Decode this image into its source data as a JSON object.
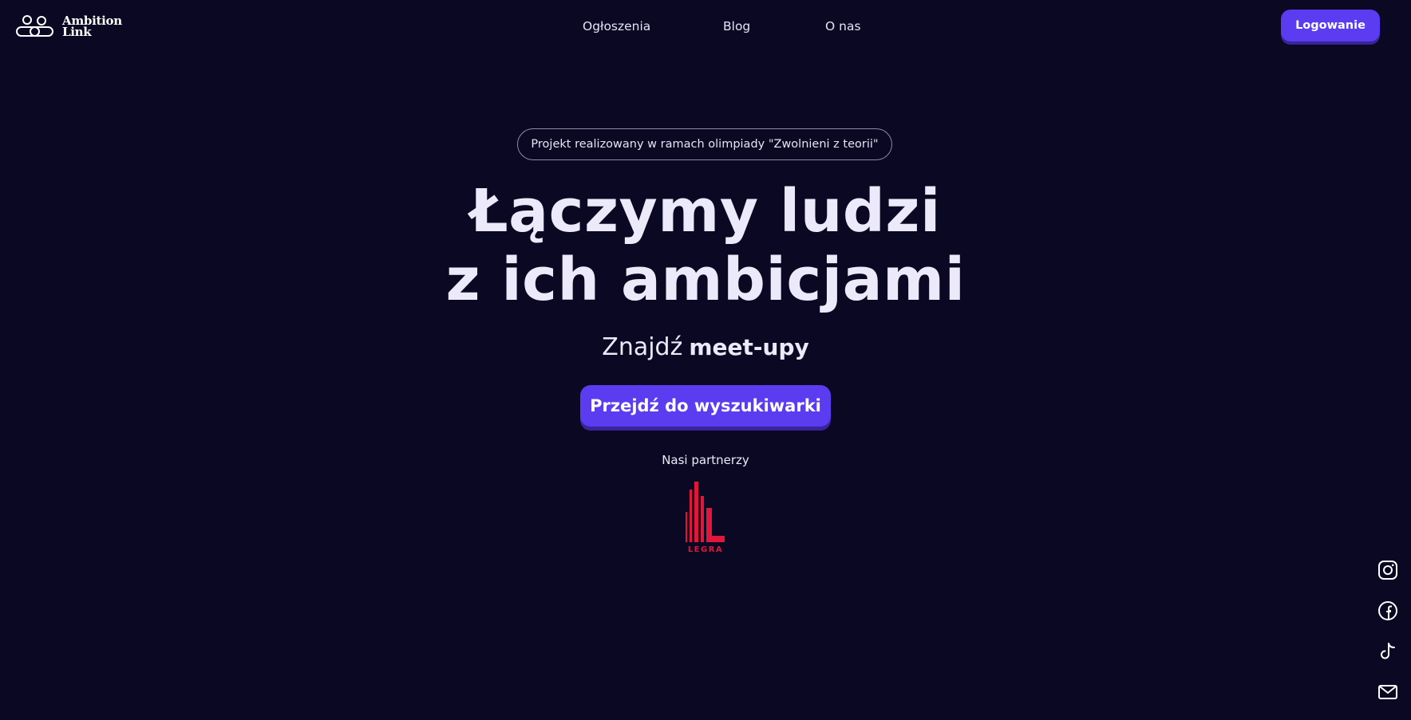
{
  "header": {
    "logo_text_line1": "Ambition",
    "logo_text_line2": "Link",
    "nav": {
      "item1": "Ogłoszenia",
      "item2": "Blog",
      "item3": "O nas"
    },
    "login_label": "Logowanie"
  },
  "hero": {
    "badge": "Projekt realizowany w ramach olimpiady \"Zwolnieni z teorii\"",
    "title_line1": "Łączymy ludzi",
    "title_line2": "z ich ambicjami",
    "subtitle_prefix": "Znajdź",
    "subtitle_highlight": "meet-upy",
    "cta_label": "Przejdź do wyszukiwarki"
  },
  "partners": {
    "label": "Nasi partnerzy",
    "logo_text": "LEGRA"
  },
  "social": {
    "icons": [
      "instagram-icon",
      "facebook-icon",
      "tiktok-icon",
      "mail-icon"
    ]
  },
  "colors": {
    "background": "#0a0822",
    "accent": "#5b3cf0",
    "accent_shadow": "#3a2499",
    "text": "#ece9fb",
    "partner_red": "#e0173a"
  }
}
